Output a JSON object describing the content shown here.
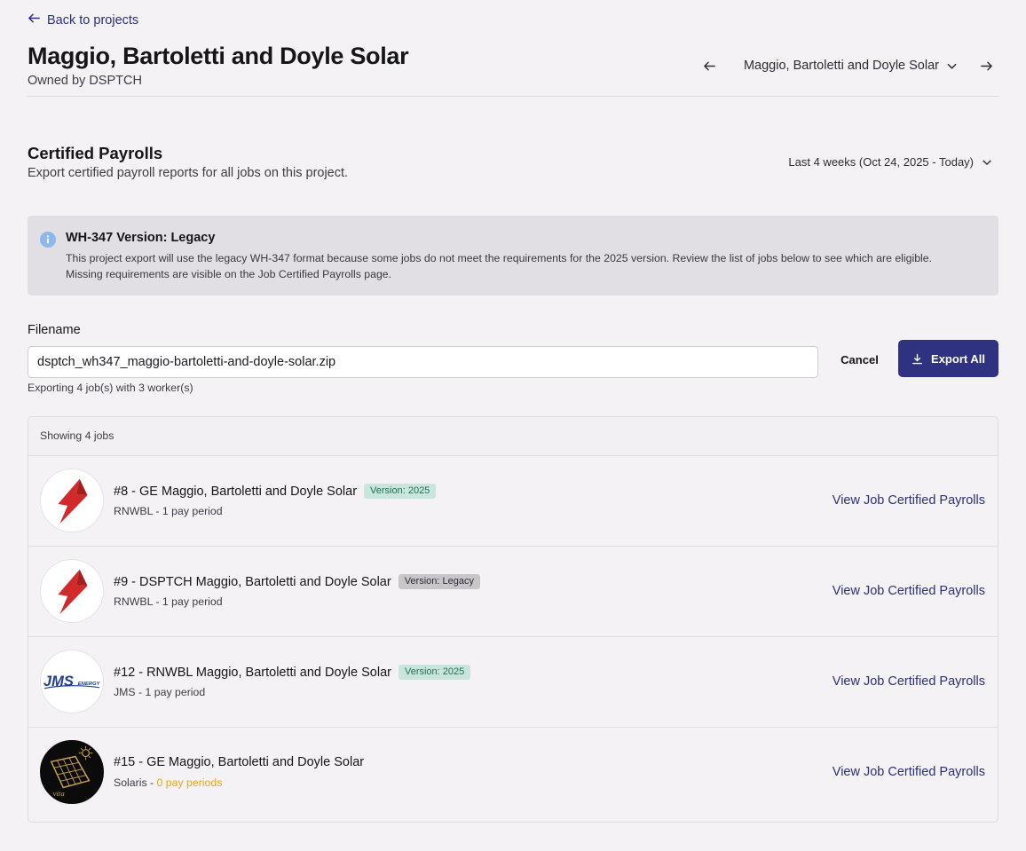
{
  "nav": {
    "back_label": "Back to projects"
  },
  "project": {
    "title": "Maggio, Bartoletti and Doyle Solar",
    "owner": "Owned by DSPTCH",
    "switcher_label": "Maggio, Bartoletti and Doyle Solar"
  },
  "section": {
    "title": "Certified Payrolls",
    "subtitle": "Export certified payroll reports for all jobs on this project.",
    "date_range": "Last 4 weeks (Oct 24, 2025 - Today)"
  },
  "banner": {
    "title": "WH-347 Version: Legacy",
    "text": "This project export will use the legacy WH-347 format because some jobs do not meet the requirements for the 2025 version. Review the list of jobs below to see which are eligible. Missing requirements are visible on the Job Certified Payrolls page."
  },
  "export": {
    "filename_label": "Filename",
    "filename_value": "dsptch_wh347_maggio-bartoletti-and-doyle-solar.zip",
    "help_text": "Exporting 4 job(s) with 3 worker(s)",
    "cancel_label": "Cancel",
    "export_label": "Export All"
  },
  "jobs": {
    "header": "Showing 4 jobs",
    "link_label": "View Job Certified Payrolls",
    "items": [
      {
        "title": "#8 - GE Maggio, Bartoletti and Doyle Solar",
        "badge": "Version: 2025",
        "company": "RNWBL - ",
        "periods": "1 pay period",
        "logo": "bolt-icon"
      },
      {
        "title": "#9 - DSPTCH Maggio, Bartoletti and Doyle Solar",
        "badge": "Version: Legacy",
        "company": "RNWBL - ",
        "periods": "1 pay period",
        "logo": "bolt-icon"
      },
      {
        "title": "#12 - RNWBL Maggio, Bartoletti and Doyle Solar",
        "badge": "Version: 2025",
        "company": "JMS - ",
        "periods": "1 pay period",
        "logo": "jms-energy-logo",
        "logo_text": "JMS",
        "logo_subtext": "ENERGY"
      },
      {
        "title": "#15 - GE Maggio, Bartoletti and Doyle Solar",
        "badge": "",
        "company": "Solaris - ",
        "periods": "0 pay periods",
        "logo": "solar-panel-logo",
        "logo_text": "vita"
      }
    ]
  },
  "colors": {
    "accent": "#2e3280",
    "link": "#2b2f7e",
    "badge_2025_bg": "#c8e6dc",
    "badge_legacy_bg": "#c8c6cb",
    "warning": "#e7a81a",
    "bolt_red": "#d22a2a"
  }
}
